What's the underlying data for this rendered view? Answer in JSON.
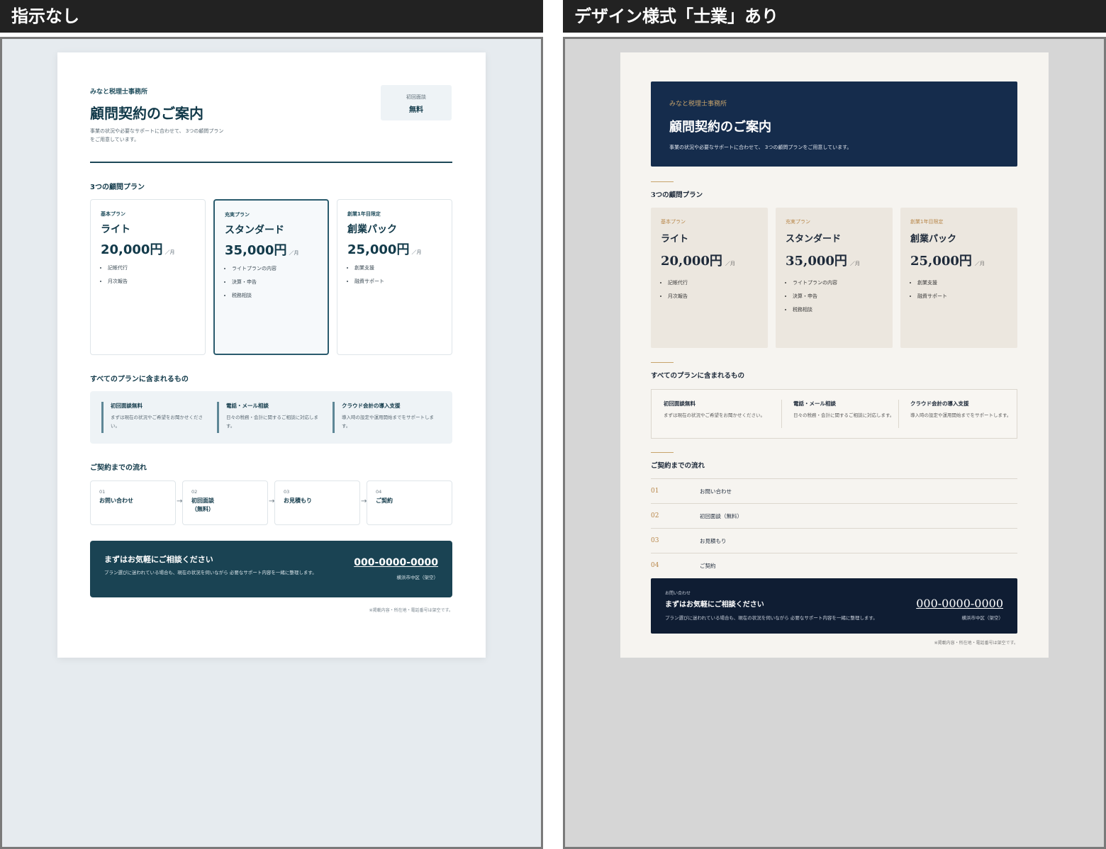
{
  "labels": {
    "left": "指示なし",
    "right": "デザイン様式「士業」あり"
  },
  "doc": {
    "office": "みなと税理士事務所",
    "title": "顧問契約のご案内",
    "lead_left": "事業の状況や必要なサポートに合わせて、 3つの顧問プランをご用意しています。",
    "lead_right": "事業の状況や必要なサポートに合わせて、 3つの顧問プランをご用意しています。",
    "badge": {
      "label": "初回面談",
      "value": "無料"
    },
    "plans_heading": "3つの顧問プラン",
    "plans": [
      {
        "tag": "基本プラン",
        "name": "ライト",
        "price": "20,000円",
        "unit": "／月",
        "features": [
          "記帳代行",
          "月次報告"
        ],
        "featured": false
      },
      {
        "tag": "充実プラン",
        "name": "スタンダード",
        "price": "35,000円",
        "unit": "／月",
        "features": [
          "ライトプランの内容",
          "決算・申告",
          "税務相談"
        ],
        "featured": true
      },
      {
        "tag": "創業1年目限定",
        "name": "創業パック",
        "price": "25,000円",
        "unit": "／月",
        "features": [
          "創業支援",
          "融資サポート"
        ],
        "featured": false
      }
    ],
    "included_heading": "すべてのプランに含まれるもの",
    "included": [
      {
        "title": "初回面談無料",
        "desc": "まずは現在の状況やご希望をお聞かせください。"
      },
      {
        "title": "電話・メール相談",
        "desc": "日々の税務・会計に関するご相談に対応します。"
      },
      {
        "title": "クラウド会計の導入支援",
        "desc": "導入時の設定や運用開始までをサポートします。"
      }
    ],
    "flow_heading": "ご契約までの流れ",
    "flow": [
      {
        "num": "01",
        "label": "お問い合わせ"
      },
      {
        "num": "02",
        "label": "初回面談（無料）"
      },
      {
        "num": "03",
        "label": "お見積もり"
      },
      {
        "num": "04",
        "label": "ご契約"
      }
    ],
    "cta": {
      "kicker": "お問い合わせ",
      "heading": "まずはお気軽にご相談ください",
      "desc": "プラン選びに迷われている場合も、現在の状況を伺いながら 必要なサポート内容を一緒に整理します。",
      "phone": "000-0000-0000",
      "address": "横浜市中区（架空）"
    },
    "note": "※掲載内容・所在地・電話番号は架空です。"
  },
  "colors": {
    "left_accent": "#1a4353",
    "right_navy": "#152c4c",
    "right_gold": "#c7a36b",
    "right_card": "#ece7df"
  }
}
